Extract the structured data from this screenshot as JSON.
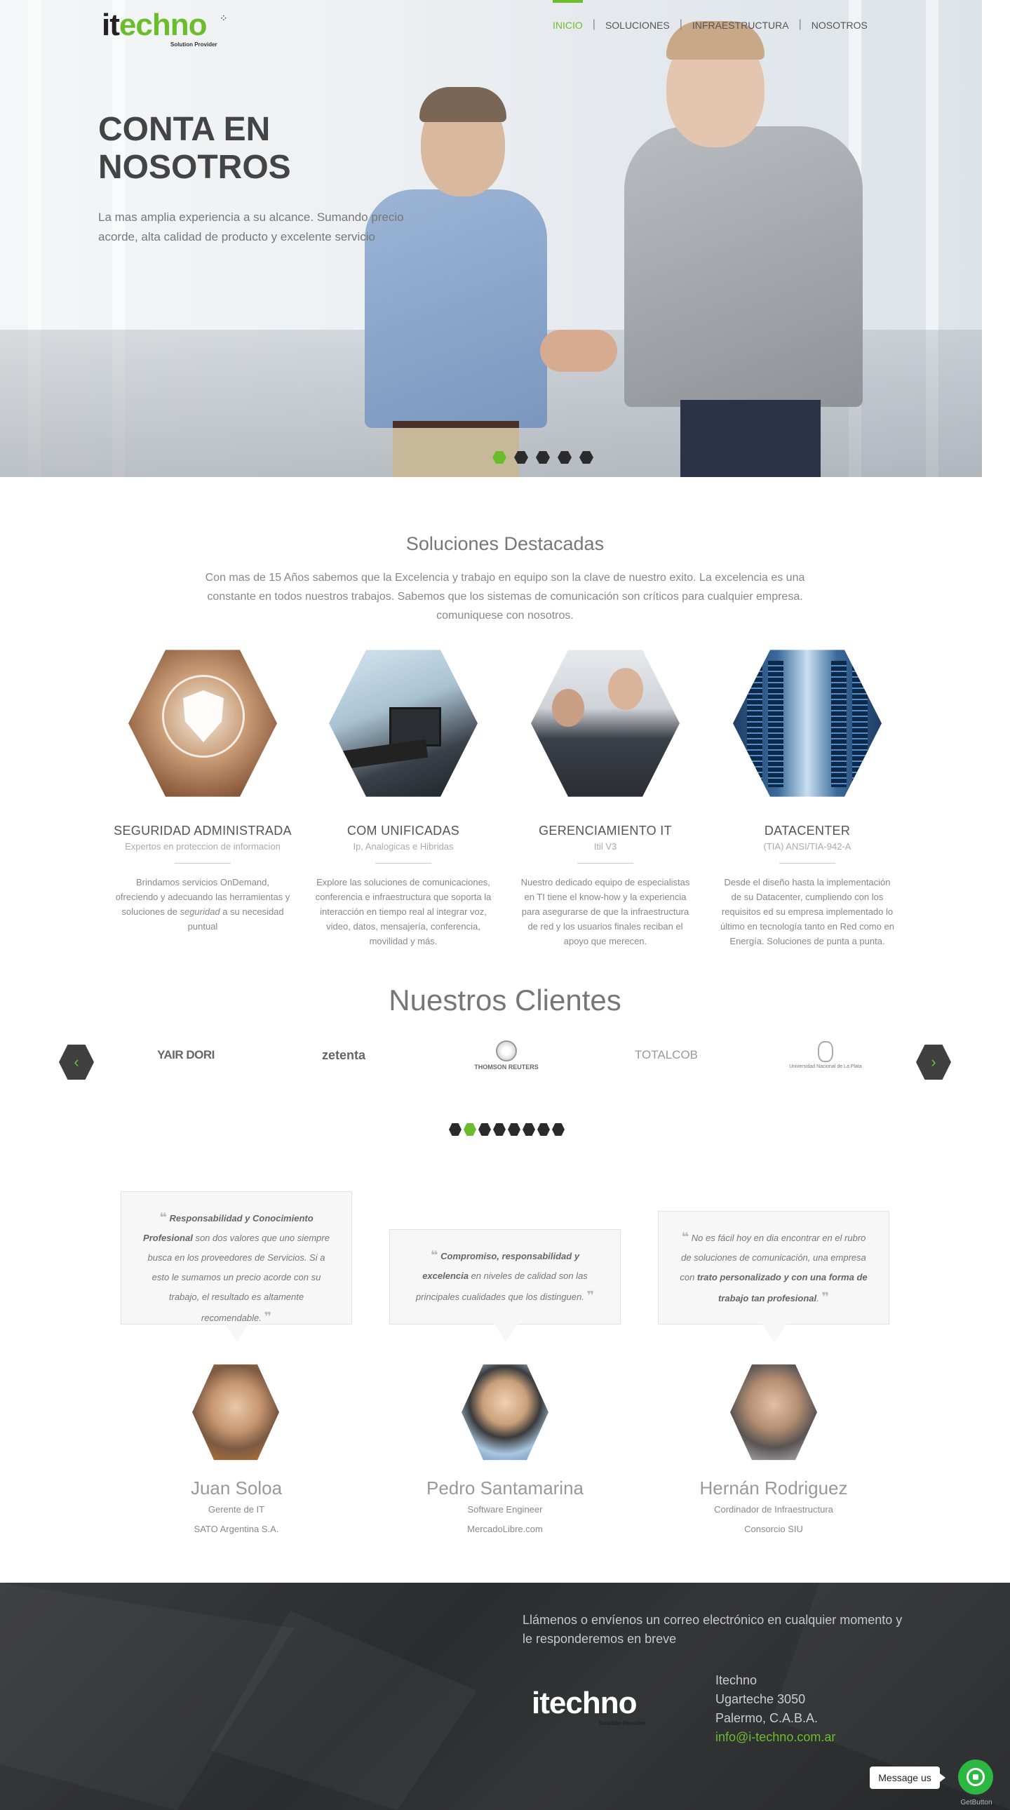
{
  "brand": {
    "logo_main": "it",
    "logo_accent": "echno",
    "tagline": "Solution Provider",
    "accent_color": "#6cbd2c"
  },
  "nav": {
    "items": [
      {
        "label": "INICIO",
        "active": true
      },
      {
        "label": "SOLUCIONES",
        "active": false
      },
      {
        "label": "INFRAESTRUCTURA",
        "active": false
      },
      {
        "label": "NOSOTROS",
        "active": false
      }
    ]
  },
  "hero": {
    "title": "CONTA EN NOSOTROS",
    "subtitle": "La mas amplia experiencia a su alcance. Sumando precio acorde, alta calidad de producto y excelente servicio",
    "slides_total": 5,
    "active_slide": 1
  },
  "solutions": {
    "title": "Soluciones Destacadas",
    "intro": "Con mas de 15 Años sabemos que la Excelencia y trabajo en equipo son la clave de nuestro exito. La excelencia es una constante en todos nuestros trabajos. Sabemos que los sistemas de comunicación son críticos para cualquier empresa. comuniquese con nosotros.",
    "cards": [
      {
        "title": "SEGURIDAD ADMINISTRADA",
        "subtitle": "Expertos en proteccion de informacion",
        "text_a": "Brindamos servicios OnDemand, ofreciendo y adecuando las herramientas y soluciones de ",
        "text_em": "seguridad",
        "text_b": " a su necesidad puntual",
        "icon": "shield-image"
      },
      {
        "title": "COM UNIFICADAS",
        "subtitle": "Ip, Analogicas e Hibridas",
        "text": "Explore las soluciones de comunicaciones, conferencia e infraestructura que soporta la interacción en tiempo real al integrar voz, video, datos, mensajería, conferencia, movilidad y más.",
        "icon": "videoconference-image"
      },
      {
        "title": "GERENCIAMIENTO IT",
        "subtitle": "Itil V3",
        "text": "Nuestro dedicado equipo de especialistas en TI tiene el know-how y la experiencia para asegurarse de que la infraestructura de red y los usuarios finales reciban el apoyo que merecen.",
        "icon": "business-meeting-image"
      },
      {
        "title": "DATACENTER",
        "subtitle": "(TIA) ANSI/TIA-942-A",
        "text": "Desde el diseño hasta la implementación de su Datacenter, cumpliendo con los requisitos ed su empresa implementado lo último en tecnología tanto en Red como en Energía. Soluciones de punta a punta.",
        "icon": "server-room-image"
      }
    ]
  },
  "clients": {
    "title": "Nuestros Clientes",
    "prev_label": "‹",
    "next_label": "›",
    "logos": [
      "YAIR DORI",
      "zetenta",
      "THOMSON REUTERS",
      "TOTALCOB",
      "Universidad Nacional de La Plata"
    ],
    "pages_total": 8,
    "active_page": 2
  },
  "testimonials": [
    {
      "q1": "Responsabilidad y Conocimiento Profesional",
      "q2": " son dos valores que uno siempre busca en los proveedores de Servicios. Si a esto le sumamos un precio acorde con su trabajo, el resultado es altamente recomendable.",
      "q3": "",
      "q4": "",
      "name": "Juan Soloa",
      "role": "Gerente de IT",
      "company": "SATO Argentina S.A."
    },
    {
      "q1": "Compromiso, responsabilidad y excelencia",
      "q2": " en niveles de calidad son las principales cualidades que los distinguen.",
      "q3": "",
      "q4": "",
      "name": "Pedro Santamarina",
      "role": "Software Engineer",
      "company": "MercadoLibre.com"
    },
    {
      "q1": "",
      "q2": "No es fácil hoy en dia encontrar en el rubro de soluciones de comunicación, una empresa con ",
      "q3": "trato personalizado y con una forma de trabajo tan profesional",
      "q4": ".",
      "name": "Hernán Rodriguez",
      "role": "Cordinador de Infraestructura",
      "company": "Consorcio SIU"
    }
  ],
  "footer": {
    "message": "Llámenos o envíenos un correo electrónico en cualquier momento y le responderemos en breve",
    "company": "Itechno",
    "street": "Ugarteche 3050",
    "city": "Palermo, C.A.B.A.",
    "email": "info@i-techno.com.ar"
  },
  "chat": {
    "label": "Message us",
    "caption": "GetButton",
    "color": "#2bb741"
  }
}
